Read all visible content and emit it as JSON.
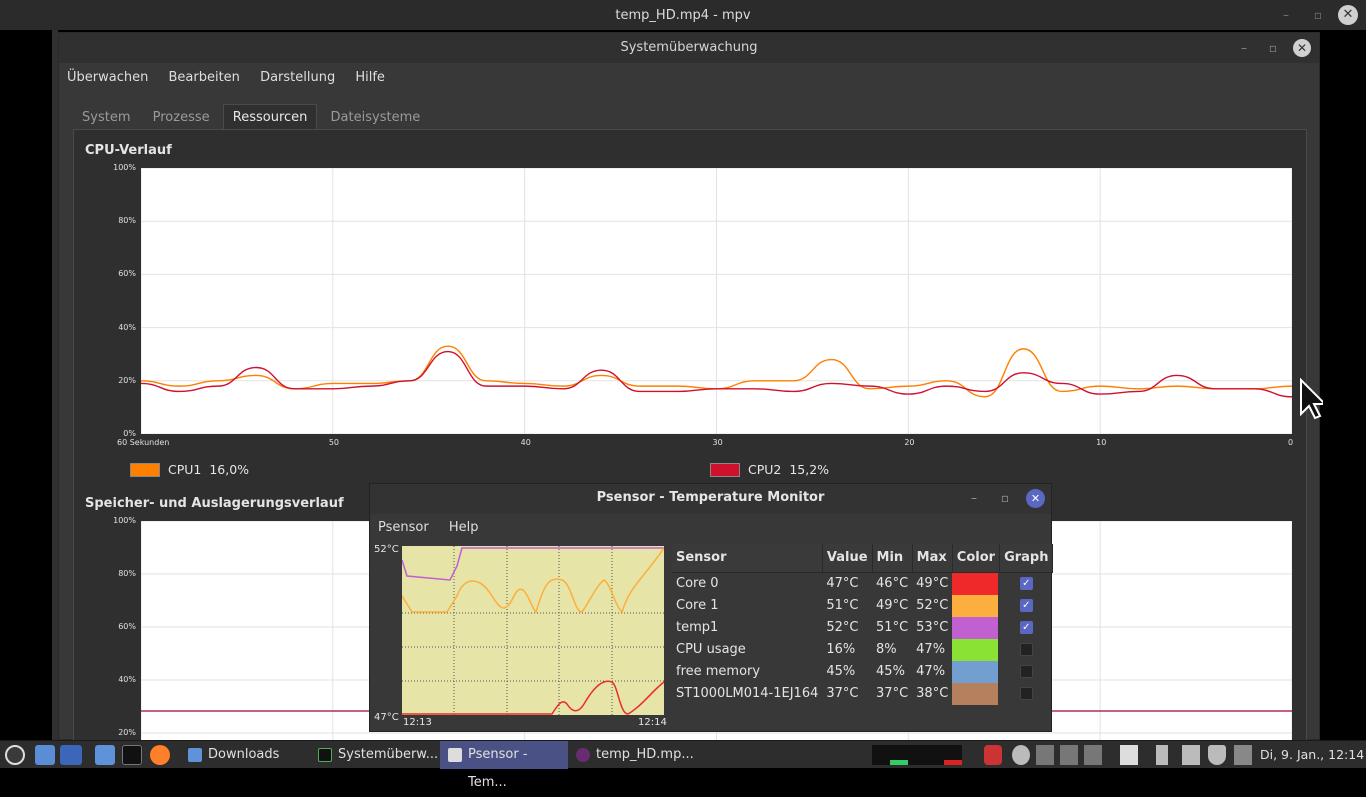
{
  "mpv": {
    "title": "temp_HD.mp4 - mpv"
  },
  "sysmon": {
    "title": "Systemüberwachung",
    "menu": [
      "Überwachen",
      "Bearbeiten",
      "Darstellung",
      "Hilfe"
    ],
    "tabs": [
      "System",
      "Prozesse",
      "Ressourcen",
      "Dateisysteme"
    ],
    "active_tab": "Ressourcen",
    "cpu_section": "CPU-Verlauf",
    "mem_section": "Speicher- und Auslagerungsverlauf",
    "y_ticks": [
      "100%",
      "80%",
      "60%",
      "40%",
      "20%",
      "0%"
    ],
    "mem_y_ticks": [
      "100%",
      "80%",
      "60%",
      "40%",
      "20%"
    ],
    "x_ticks": [
      "60 Sekunden",
      "50",
      "40",
      "30",
      "20",
      "10",
      "0"
    ],
    "legend": [
      {
        "label": "CPU1",
        "value": "16,0%",
        "color": "#ff7f00"
      },
      {
        "label": "CPU2",
        "value": "15,2%",
        "color": "#d0112e"
      }
    ]
  },
  "chart_data": {
    "type": "line",
    "title": "CPU-Verlauf",
    "x": [
      60,
      58,
      56,
      54,
      52,
      50,
      48,
      46,
      44,
      42,
      40,
      38,
      36,
      34,
      32,
      30,
      28,
      26,
      24,
      22,
      20,
      18,
      16,
      14,
      12,
      10,
      8,
      6,
      4,
      2,
      0
    ],
    "xlabel": "Sekunden",
    "ylim": [
      0,
      100
    ],
    "series": [
      {
        "name": "CPU1",
        "values": [
          20,
          18,
          20,
          22,
          17,
          19,
          19,
          20,
          33,
          20,
          19,
          18,
          22,
          18,
          18,
          17,
          20,
          20,
          28,
          17,
          18,
          20,
          14,
          32,
          16,
          18,
          17,
          18,
          17,
          17,
          18
        ]
      },
      {
        "name": "CPU2",
        "values": [
          19,
          16,
          18,
          25,
          17,
          17,
          18,
          20,
          31,
          18,
          18,
          17,
          24,
          16,
          16,
          17,
          17,
          16,
          19,
          18,
          15,
          18,
          16,
          23,
          19,
          15,
          16,
          22,
          17,
          17,
          14
        ]
      }
    ],
    "grid": true
  },
  "psensor": {
    "title": "Psensor - Temperature Monitor",
    "menu": [
      "Psensor",
      "Help"
    ],
    "graph_max": "52°C",
    "graph_min": "47°C",
    "time_start": "12:13",
    "time_end": "12:14",
    "headers": [
      "Sensor",
      "Value",
      "Min",
      "Max",
      "Color",
      "Graph"
    ],
    "rows": [
      {
        "sensor": "Core 0",
        "value": "47°C",
        "min": "46°C",
        "max": "49°C",
        "color": "#ef2929",
        "graph": true
      },
      {
        "sensor": "Core 1",
        "value": "51°C",
        "min": "49°C",
        "max": "52°C",
        "color": "#fcaf3e",
        "graph": true
      },
      {
        "sensor": "temp1",
        "value": "52°C",
        "min": "51°C",
        "max": "53°C",
        "color": "#c160d0",
        "graph": true
      },
      {
        "sensor": "CPU usage",
        "value": "16%",
        "min": "8%",
        "max": "47%",
        "color": "#8ae234",
        "graph": false
      },
      {
        "sensor": "free memory",
        "value": "45%",
        "min": "45%",
        "max": "47%",
        "color": "#729fcf",
        "graph": false
      },
      {
        "sensor": "ST1000LM014-1EJ164",
        "value": "37°C",
        "min": "37°C",
        "max": "38°C",
        "color": "#b6805e",
        "graph": false
      }
    ]
  },
  "taskbar": {
    "items": [
      {
        "label": "Downloads"
      },
      {
        "label": "Systemüberw..."
      },
      {
        "label": "Psensor - Tem..."
      },
      {
        "label": "temp_HD.mp..."
      }
    ],
    "clock": "Di, 9. Jan., 12:14"
  }
}
